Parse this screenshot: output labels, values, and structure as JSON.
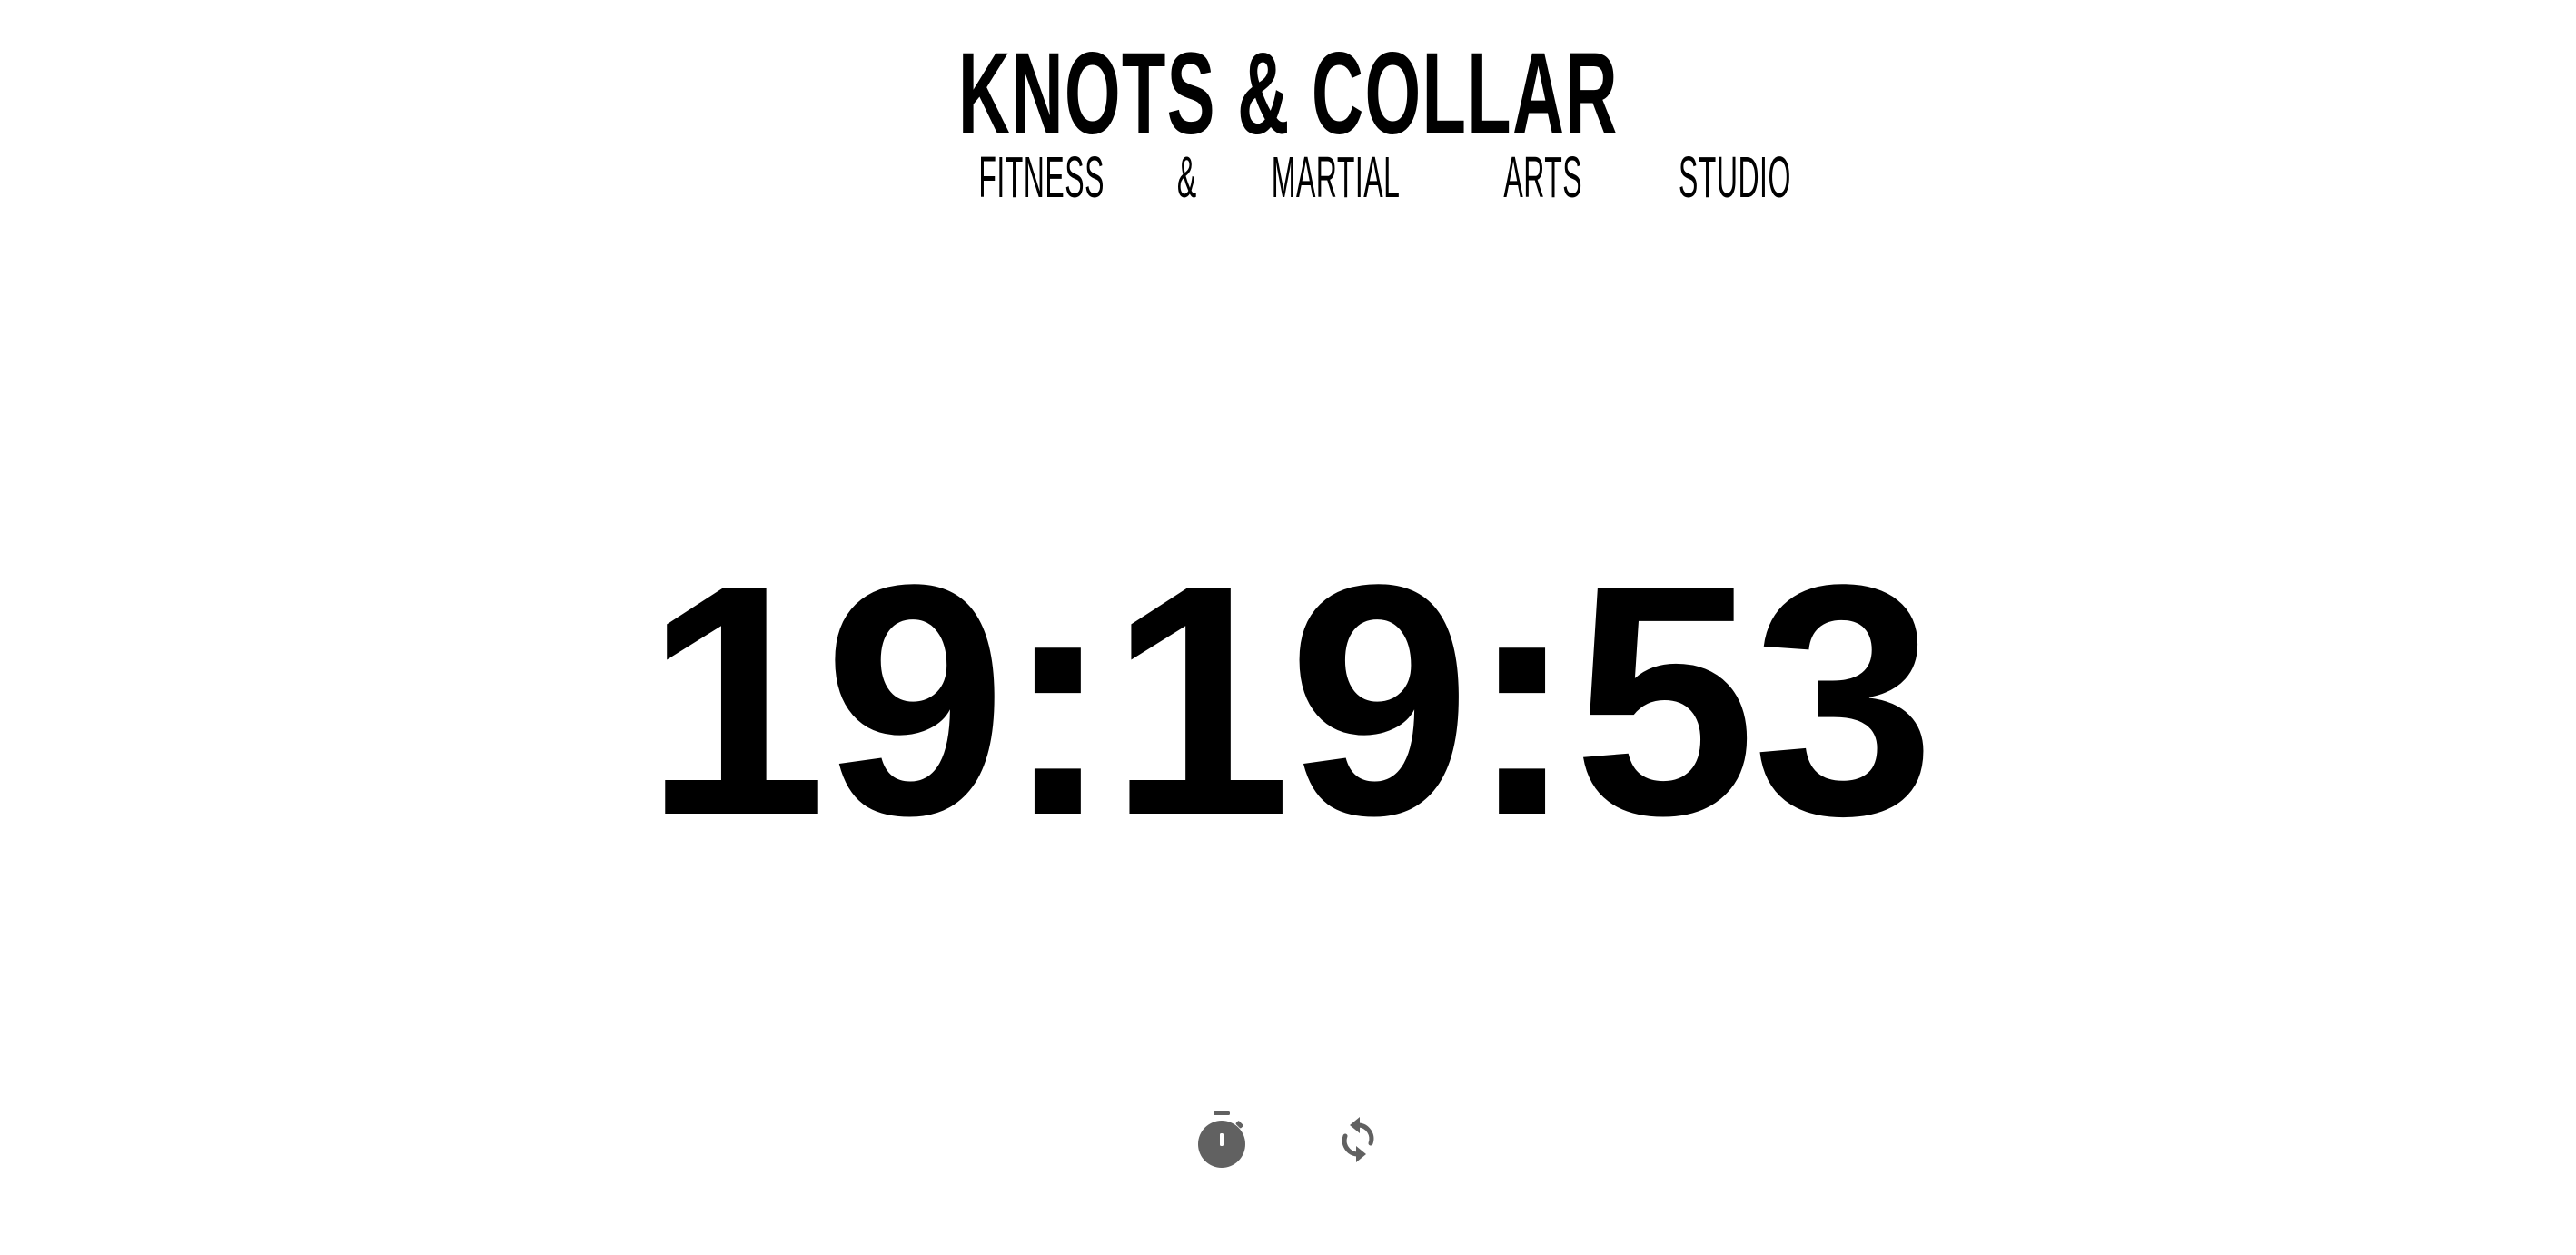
{
  "header": {
    "brand_name": "KNOTS & COLLAR",
    "tagline_words": [
      "FITNESS",
      "&",
      "MARTIAL",
      "ARTS",
      "STUDIO"
    ]
  },
  "clock": {
    "time": "19:19:53"
  },
  "controls": {
    "timer_icon": "stopwatch-icon",
    "reset_icon": "refresh-icon",
    "icon_color": "#616161"
  },
  "colors": {
    "text": "#000000",
    "background": "#ffffff"
  }
}
